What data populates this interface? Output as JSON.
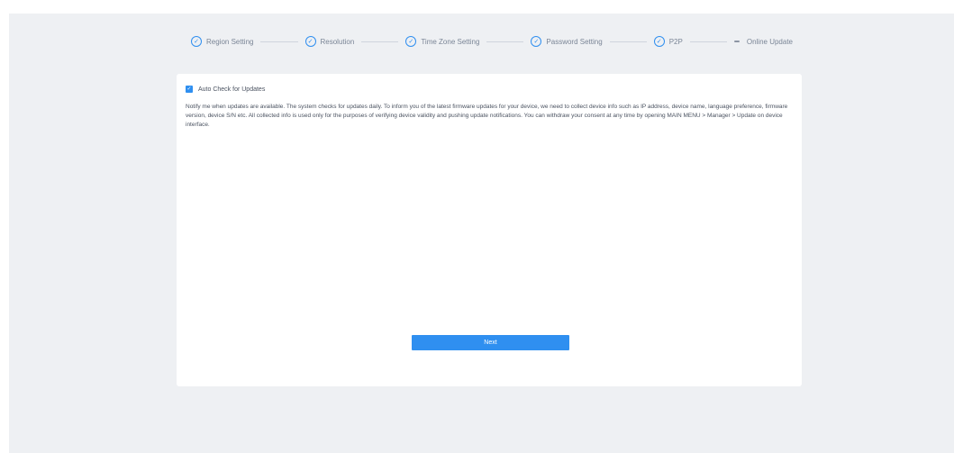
{
  "stepper": {
    "steps": [
      {
        "label": "Region Setting"
      },
      {
        "label": "Resolution"
      },
      {
        "label": "Time Zone Setting"
      },
      {
        "label": "Password Setting"
      },
      {
        "label": "P2P"
      },
      {
        "label": "Online Update"
      }
    ]
  },
  "update": {
    "checkbox_label": "Auto Check for Updates",
    "checked": true,
    "notice": "Notify me when updates are available. The system checks for updates daily. To inform you of the latest firmware updates for your device, we need to collect device info such as IP address, device name, language preference, firmware version, device S/N etc. All collected info is used only for the purposes of verifying device validity and pushing update notifications. You can withdraw your consent at any time by opening MAIN MENU > Manager > Update on device interface."
  },
  "footer": {
    "next_label": "Next"
  },
  "colors": {
    "accent": "#2f8ff0",
    "page_bg": "#eef0f3",
    "card_bg": "#ffffff",
    "text": "#4a5260"
  }
}
